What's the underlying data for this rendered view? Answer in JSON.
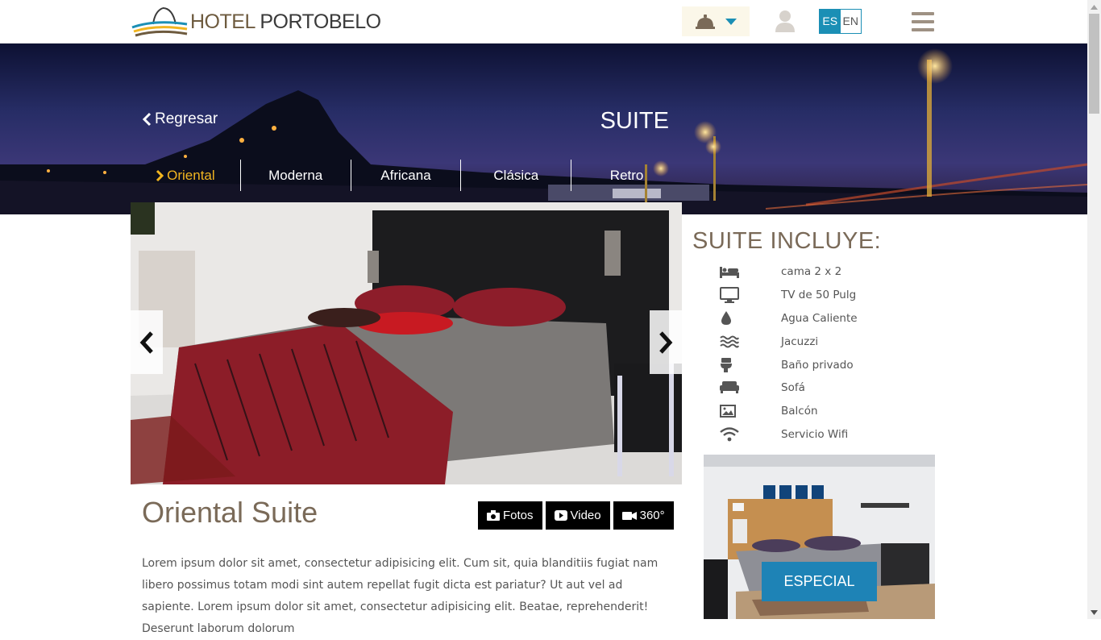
{
  "header": {
    "logo_text_a": "HOTEL",
    "logo_text_b": "PORTOBELO",
    "bell_icon": "bell-icon",
    "dropdown_icon": "caret-down-icon",
    "user_icon": "user-icon",
    "lang_es": "ES",
    "lang_en": "EN",
    "menu_icon": "hamburger-icon"
  },
  "hero": {
    "back_label": "Regresar",
    "title": "SUITE",
    "tabs": [
      {
        "label": "Oriental",
        "active": true
      },
      {
        "label": "Moderna"
      },
      {
        "label": "Africana"
      },
      {
        "label": "Clásica"
      },
      {
        "label": "Retro"
      }
    ]
  },
  "room": {
    "name": "Oriental Suite",
    "media": {
      "photos": "Fotos",
      "video": "Video",
      "tour": "360°"
    },
    "description": "Lorem ipsum dolor sit amet, consectetur adipisicing elit. Cum sit, quia blanditiis fugiat nam libero possimus totam modi sint autem repellat fugit dicta est pariatur? Ut aut vel ad sapiente. Lorem ipsum dolor sit amet, consectetur adipisicing elit. Beatae, reprehenderit! Deserunt laborum dolorum"
  },
  "includes": {
    "title": "SUITE INCLUYE:",
    "items": [
      {
        "icon": "bed-icon",
        "label": "cama 2 x 2"
      },
      {
        "icon": "tv-icon",
        "label": "TV de 50 Pulg"
      },
      {
        "icon": "water-drop-icon",
        "label": "Agua Caliente"
      },
      {
        "icon": "waves-icon",
        "label": "Jacuzzi"
      },
      {
        "icon": "toilet-icon",
        "label": "Baño privado"
      },
      {
        "icon": "sofa-icon",
        "label": "Sofá"
      },
      {
        "icon": "image-icon",
        "label": "Balcón"
      },
      {
        "icon": "wifi-icon",
        "label": "Servicio Wifi"
      }
    ]
  },
  "promo": {
    "button_label": "ESPECIAL"
  },
  "colors": {
    "accent": "#1e83b6",
    "active_tab": "#f1b520",
    "heading": "#7a6a58"
  }
}
